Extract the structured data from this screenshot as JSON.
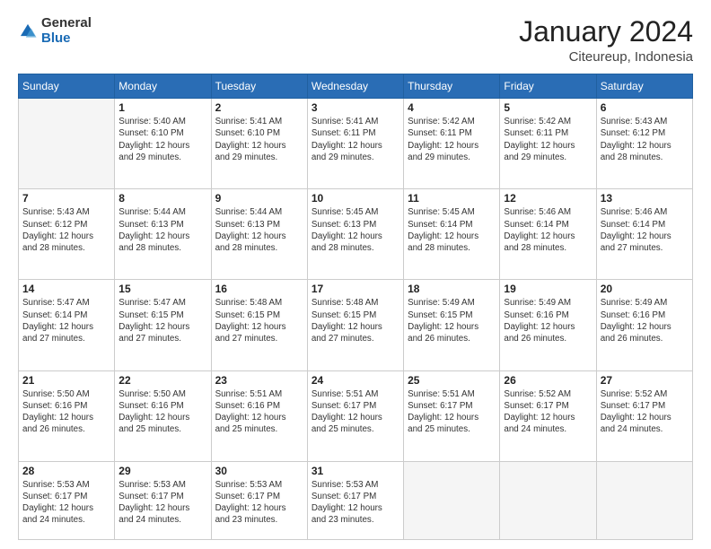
{
  "header": {
    "logo_line1": "General",
    "logo_line2": "Blue",
    "title": "January 2024",
    "subtitle": "Citeureup, Indonesia"
  },
  "days_of_week": [
    "Sunday",
    "Monday",
    "Tuesday",
    "Wednesday",
    "Thursday",
    "Friday",
    "Saturday"
  ],
  "weeks": [
    [
      {
        "num": "",
        "info": ""
      },
      {
        "num": "1",
        "info": "Sunrise: 5:40 AM\nSunset: 6:10 PM\nDaylight: 12 hours\nand 29 minutes."
      },
      {
        "num": "2",
        "info": "Sunrise: 5:41 AM\nSunset: 6:10 PM\nDaylight: 12 hours\nand 29 minutes."
      },
      {
        "num": "3",
        "info": "Sunrise: 5:41 AM\nSunset: 6:11 PM\nDaylight: 12 hours\nand 29 minutes."
      },
      {
        "num": "4",
        "info": "Sunrise: 5:42 AM\nSunset: 6:11 PM\nDaylight: 12 hours\nand 29 minutes."
      },
      {
        "num": "5",
        "info": "Sunrise: 5:42 AM\nSunset: 6:11 PM\nDaylight: 12 hours\nand 29 minutes."
      },
      {
        "num": "6",
        "info": "Sunrise: 5:43 AM\nSunset: 6:12 PM\nDaylight: 12 hours\nand 28 minutes."
      }
    ],
    [
      {
        "num": "7",
        "info": "Sunrise: 5:43 AM\nSunset: 6:12 PM\nDaylight: 12 hours\nand 28 minutes."
      },
      {
        "num": "8",
        "info": "Sunrise: 5:44 AM\nSunset: 6:13 PM\nDaylight: 12 hours\nand 28 minutes."
      },
      {
        "num": "9",
        "info": "Sunrise: 5:44 AM\nSunset: 6:13 PM\nDaylight: 12 hours\nand 28 minutes."
      },
      {
        "num": "10",
        "info": "Sunrise: 5:45 AM\nSunset: 6:13 PM\nDaylight: 12 hours\nand 28 minutes."
      },
      {
        "num": "11",
        "info": "Sunrise: 5:45 AM\nSunset: 6:14 PM\nDaylight: 12 hours\nand 28 minutes."
      },
      {
        "num": "12",
        "info": "Sunrise: 5:46 AM\nSunset: 6:14 PM\nDaylight: 12 hours\nand 28 minutes."
      },
      {
        "num": "13",
        "info": "Sunrise: 5:46 AM\nSunset: 6:14 PM\nDaylight: 12 hours\nand 27 minutes."
      }
    ],
    [
      {
        "num": "14",
        "info": "Sunrise: 5:47 AM\nSunset: 6:14 PM\nDaylight: 12 hours\nand 27 minutes."
      },
      {
        "num": "15",
        "info": "Sunrise: 5:47 AM\nSunset: 6:15 PM\nDaylight: 12 hours\nand 27 minutes."
      },
      {
        "num": "16",
        "info": "Sunrise: 5:48 AM\nSunset: 6:15 PM\nDaylight: 12 hours\nand 27 minutes."
      },
      {
        "num": "17",
        "info": "Sunrise: 5:48 AM\nSunset: 6:15 PM\nDaylight: 12 hours\nand 27 minutes."
      },
      {
        "num": "18",
        "info": "Sunrise: 5:49 AM\nSunset: 6:15 PM\nDaylight: 12 hours\nand 26 minutes."
      },
      {
        "num": "19",
        "info": "Sunrise: 5:49 AM\nSunset: 6:16 PM\nDaylight: 12 hours\nand 26 minutes."
      },
      {
        "num": "20",
        "info": "Sunrise: 5:49 AM\nSunset: 6:16 PM\nDaylight: 12 hours\nand 26 minutes."
      }
    ],
    [
      {
        "num": "21",
        "info": "Sunrise: 5:50 AM\nSunset: 6:16 PM\nDaylight: 12 hours\nand 26 minutes."
      },
      {
        "num": "22",
        "info": "Sunrise: 5:50 AM\nSunset: 6:16 PM\nDaylight: 12 hours\nand 25 minutes."
      },
      {
        "num": "23",
        "info": "Sunrise: 5:51 AM\nSunset: 6:16 PM\nDaylight: 12 hours\nand 25 minutes."
      },
      {
        "num": "24",
        "info": "Sunrise: 5:51 AM\nSunset: 6:17 PM\nDaylight: 12 hours\nand 25 minutes."
      },
      {
        "num": "25",
        "info": "Sunrise: 5:51 AM\nSunset: 6:17 PM\nDaylight: 12 hours\nand 25 minutes."
      },
      {
        "num": "26",
        "info": "Sunrise: 5:52 AM\nSunset: 6:17 PM\nDaylight: 12 hours\nand 24 minutes."
      },
      {
        "num": "27",
        "info": "Sunrise: 5:52 AM\nSunset: 6:17 PM\nDaylight: 12 hours\nand 24 minutes."
      }
    ],
    [
      {
        "num": "28",
        "info": "Sunrise: 5:53 AM\nSunset: 6:17 PM\nDaylight: 12 hours\nand 24 minutes."
      },
      {
        "num": "29",
        "info": "Sunrise: 5:53 AM\nSunset: 6:17 PM\nDaylight: 12 hours\nand 24 minutes."
      },
      {
        "num": "30",
        "info": "Sunrise: 5:53 AM\nSunset: 6:17 PM\nDaylight: 12 hours\nand 23 minutes."
      },
      {
        "num": "31",
        "info": "Sunrise: 5:53 AM\nSunset: 6:17 PM\nDaylight: 12 hours\nand 23 minutes."
      },
      {
        "num": "",
        "info": ""
      },
      {
        "num": "",
        "info": ""
      },
      {
        "num": "",
        "info": ""
      }
    ]
  ]
}
